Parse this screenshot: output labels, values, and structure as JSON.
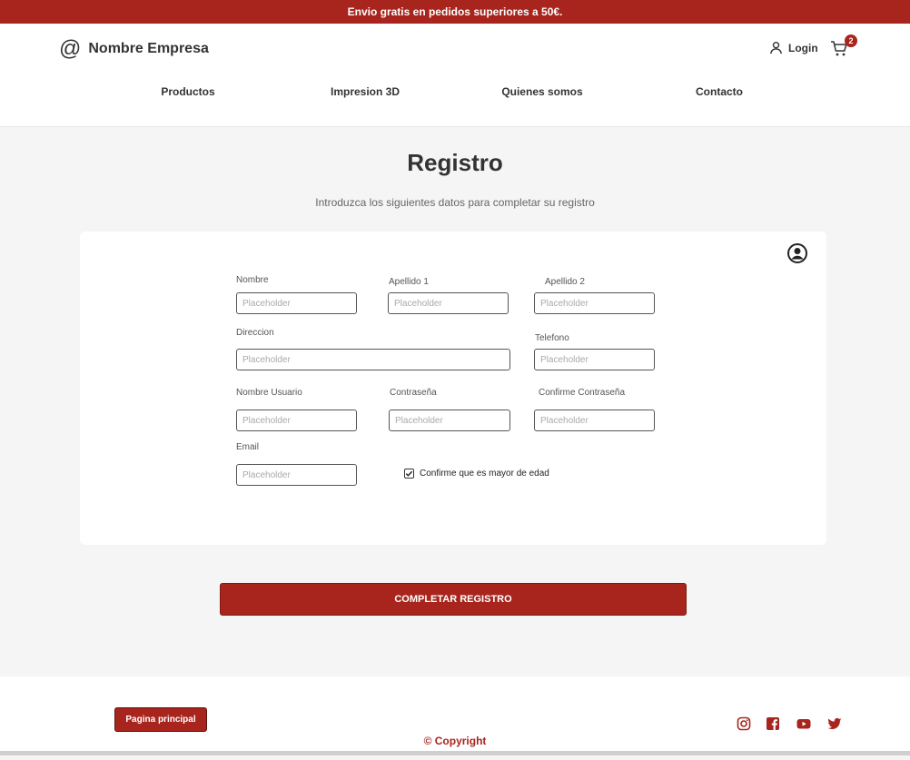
{
  "promo": {
    "text": "Envio gratis en pedidos superiores a 50€."
  },
  "header": {
    "brand_symbol": "@",
    "brand_name": "Nombre Empresa",
    "login_label": "Login",
    "cart_count": "2",
    "nav": [
      "Productos",
      "Impresion 3D",
      "Quienes somos",
      "Contacto"
    ]
  },
  "page": {
    "title": "Registro",
    "subtitle": "Introduzca los siguientes datos para completar su registro"
  },
  "form": {
    "placeholder": "Placeholder",
    "labels": {
      "nombre": "Nombre",
      "apellido1": "Apellido 1",
      "apellido2": "Apellido 2",
      "direccion": "Direccion",
      "telefono": "Telefono",
      "usuario": "Nombre Usuario",
      "contrasena": "Contraseña",
      "confirme": "Confirme Contraseña",
      "email": "Email"
    },
    "checkbox_label": "Confirme que es mayor de edad",
    "checkbox_checked": true,
    "submit_label": "COMPLETAR REGISTRO"
  },
  "footer": {
    "home_label": "Pagina principal",
    "copyright_symbol": "©",
    "copyright_text": "Copyright",
    "social": [
      "instagram-icon",
      "facebook-icon",
      "youtube-icon",
      "twitter-icon"
    ]
  },
  "colors": {
    "accent": "#a8251d",
    "background": "#f5f5f5",
    "text": "#333333"
  }
}
